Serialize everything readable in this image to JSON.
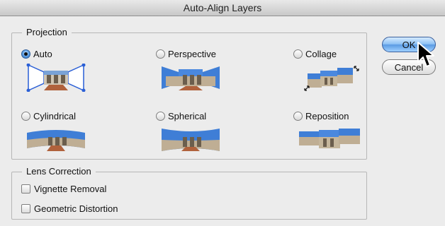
{
  "window": {
    "title": "Auto-Align Layers"
  },
  "projection": {
    "legend": "Projection",
    "options": [
      {
        "label": "Auto",
        "selected": true,
        "icon": "auto-preview-icon"
      },
      {
        "label": "Perspective",
        "selected": false,
        "icon": "perspective-preview-icon"
      },
      {
        "label": "Collage",
        "selected": false,
        "icon": "collage-preview-icon"
      },
      {
        "label": "Cylindrical",
        "selected": false,
        "icon": "cylindrical-preview-icon"
      },
      {
        "label": "Spherical",
        "selected": false,
        "icon": "spherical-preview-icon"
      },
      {
        "label": "Reposition",
        "selected": false,
        "icon": "reposition-preview-icon"
      }
    ]
  },
  "lens": {
    "legend": "Lens Correction",
    "vignette_label": "Vignette Removal",
    "vignette_checked": false,
    "geometric_label": "Geometric Distortion",
    "geometric_checked": false
  },
  "buttons": {
    "ok": "OK",
    "cancel": "Cancel"
  },
  "colors": {
    "sky": "#3f7ed6",
    "building": "#b7a58d",
    "accent": "#5a9ae3"
  }
}
